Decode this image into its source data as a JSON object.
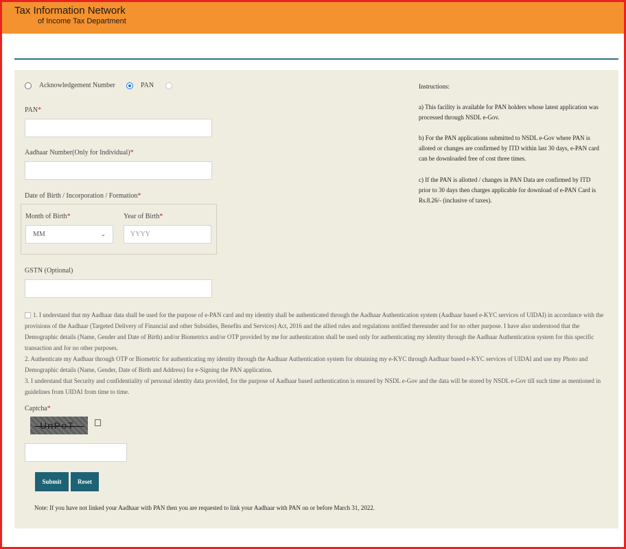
{
  "header": {
    "title": "Tax Information Network",
    "subtitle": "of Income Tax Department"
  },
  "selection": {
    "options": [
      "Acknowledgement Number",
      "PAN"
    ],
    "selected": "PAN"
  },
  "form": {
    "pan_label": "PAN",
    "aadhaar_label": "Aadhaar Number(Only for Individual)",
    "dob_label": "Date of Birth / Incorporation / Formation",
    "month_label": "Month of Birth",
    "month_value": "MM",
    "year_label": "Year of Birth",
    "year_placeholder": "YYYY",
    "gstn_label": "GSTN (Optional)",
    "required_mark": "*"
  },
  "declaration": {
    "line1": "1. I understand that my Aadhaar data shall be used for the purpose of e-PAN card and my identity shall be authenticated through the Aadhaar Authentication system (Aadhaar based e-KYC services of UIDAI) in accordance with the provisions of the Aadhaar (Targeted Delivery of Financial and other Subsidies, Benefits and Services) Act, 2016 and the allied rules and regulations notified thereunder and for no other purpose. I have also understood that the Demographic details (Name, Gender and Date of Birth) and/or Biometrics and/or OTP provided by me for authentication shall be used only for authenticating my identity through the Aadhaar Authentication system for this specific transaction and for no other purposes.",
    "line2": "2. Authenticate my Aadhaar through OTP or Biometric for authenticating my identity through the Aadhaar Authentication system for obtaining my e-KYC through Aadhaar based e-KYC services of UIDAI and use my Photo and Demographic details (Name, Gender, Date of Birth and Address) for e-Signing the PAN application.",
    "line3": "3. I understand that Security and confidentiality of personal identity data provided, for the purpose of Aadhaar based authentication is ensured by NSDL e-Gov and the data will be stored by NSDL e-Gov till such time as mentioned in guidelines from UIDAI from time to time."
  },
  "captcha": {
    "label": "Captcha",
    "image_text": "UnPoT"
  },
  "buttons": {
    "submit": "Submit",
    "reset": "Reset"
  },
  "note": "Note: If you have not linked your Aadhaar with PAN then you are requested to link your Aadhaar with PAN on or before March 31, 2022.",
  "instructions": {
    "heading": "Instructions:",
    "a": "a) This facility is available for PAN holders whose latest application was processed through NSDL e-Gov.",
    "b": "b) For the PAN applications submitted to NSDL e-Gov where PAN is alloted or changes are confirmed by ITD within last 30 days, e-PAN card can be downloaded free of cost three times.",
    "c": "c) If the PAN is allotted / changes in PAN Data are confirmed by ITD prior to 30 days then charges applicable for download of e-PAN Card is Rs.8.26/- (inclusive of taxes)."
  },
  "colors": {
    "header_bg": "#f4922f",
    "panel_bg": "#efede0",
    "button_bg": "#1d6375",
    "frame": "#e8231f"
  }
}
